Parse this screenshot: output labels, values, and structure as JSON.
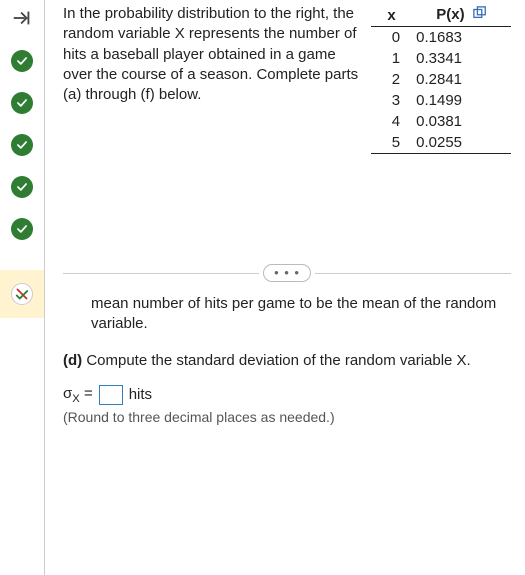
{
  "sidebar": {
    "skip_icon": "skip-forward-icon",
    "statuses": [
      "ok",
      "ok",
      "ok",
      "ok",
      "ok"
    ],
    "partial_icon": "partial-correct-icon"
  },
  "problem": {
    "intro": "In the probability distribution to the right, the random variable X represents the number of hits a baseball player obtained in a game over the course of a season. Complete parts (a) through (f) below."
  },
  "table": {
    "headers": {
      "x": "x",
      "px": "P(x)"
    },
    "rows": [
      {
        "x": "0",
        "px": "0.1683"
      },
      {
        "x": "1",
        "px": "0.3341"
      },
      {
        "x": "2",
        "px": "0.2841"
      },
      {
        "x": "3",
        "px": "0.1499"
      },
      {
        "x": "4",
        "px": "0.0381"
      },
      {
        "x": "5",
        "px": "0.0255"
      }
    ],
    "popup_icon": "popup-table-icon"
  },
  "expand": {
    "ellipsis": "• • •"
  },
  "sub": {
    "text": "mean number of hits per game to be the mean of the random variable."
  },
  "part_d": {
    "label": "(d)",
    "prompt": "Compute the standard deviation of the random variable X.",
    "sigma_label_prefix": "σ",
    "sigma_sub": "X",
    "equals": "=",
    "answer_value": "",
    "units": "hits",
    "hint": "(Round to three decimal places as needed.)"
  }
}
